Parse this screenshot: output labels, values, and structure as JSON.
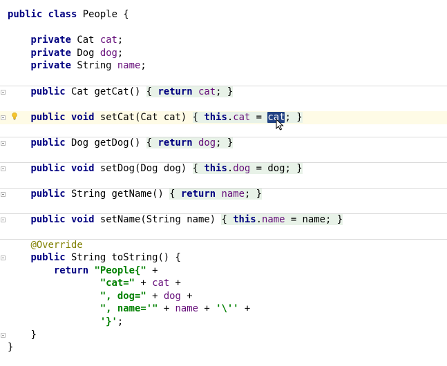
{
  "editor": {
    "lines": {
      "l01": {
        "a": "public",
        "b": " ",
        "c": "class",
        "d": " People {"
      },
      "l03": {
        "a": "    ",
        "b": "private",
        "c": " Cat ",
        "d": "cat",
        "e": ";"
      },
      "l04": {
        "a": "    ",
        "b": "private",
        "c": " Dog ",
        "d": "dog",
        "e": ";"
      },
      "l05": {
        "a": "    ",
        "b": "private",
        "c": " String ",
        "d": "name",
        "e": ";"
      },
      "l07": {
        "a": "    ",
        "b": "public",
        "c": " Cat getCat() ",
        "d": "{ ",
        "e": "return",
        "f": " ",
        "g": "cat",
        "h": "; }"
      },
      "l09": {
        "a": "    ",
        "b": "public",
        "c": " ",
        "d": "void",
        "e": " setCat(Cat cat) ",
        "f": "{ ",
        "g": "this",
        "h": ".",
        "i": "cat",
        "j": " = ",
        "k": "cat",
        "l": "; }"
      },
      "l11": {
        "a": "    ",
        "b": "public",
        "c": " Dog getDog() ",
        "d": "{ ",
        "e": "return",
        "f": " ",
        "g": "dog",
        "h": "; }"
      },
      "l13": {
        "a": "    ",
        "b": "public",
        "c": " ",
        "d": "void",
        "e": " setDog(Dog dog) ",
        "f": "{ ",
        "g": "this",
        "h": ".",
        "i": "dog",
        "j": " = dog; }"
      },
      "l15": {
        "a": "    ",
        "b": "public",
        "c": " String getName() ",
        "d": "{ ",
        "e": "return",
        "f": " ",
        "g": "name",
        "h": "; }"
      },
      "l17": {
        "a": "    ",
        "b": "public",
        "c": " ",
        "d": "void",
        "e": " setName(String name) ",
        "f": "{ ",
        "g": "this",
        "h": ".",
        "i": "name",
        "j": " = name; }"
      },
      "l19": {
        "a": "    ",
        "b": "@Override"
      },
      "l20": {
        "a": "    ",
        "b": "public",
        "c": " String toString() {"
      },
      "l21": {
        "a": "        ",
        "b": "return",
        "c": " ",
        "d": "\"People{\"",
        "e": " +"
      },
      "l22": {
        "a": "                ",
        "b": "\"cat=\"",
        "c": " + ",
        "d": "cat",
        "e": " +"
      },
      "l23": {
        "a": "                ",
        "b": "\", dog=\"",
        "c": " + ",
        "d": "dog",
        "e": " +"
      },
      "l24": {
        "a": "                ",
        "b": "\", name='\"",
        "c": " + ",
        "d": "name",
        "e": " + ",
        "f": "'\\''",
        "g": " +"
      },
      "l25": {
        "a": "                ",
        "b": "'}'",
        "c": ";"
      },
      "l26": {
        "a": "    ",
        "b": "}"
      },
      "l27": {
        "a": "}"
      }
    },
    "colors": {
      "keyword": "#000080",
      "field": "#660e7a",
      "string": "#008000",
      "annotation": "#808000",
      "selection": "#214283",
      "current_line": "#fefbe6"
    },
    "icons": [
      "fold-marker-icon",
      "lightbulb-icon",
      "mouse-cursor-icon"
    ]
  }
}
